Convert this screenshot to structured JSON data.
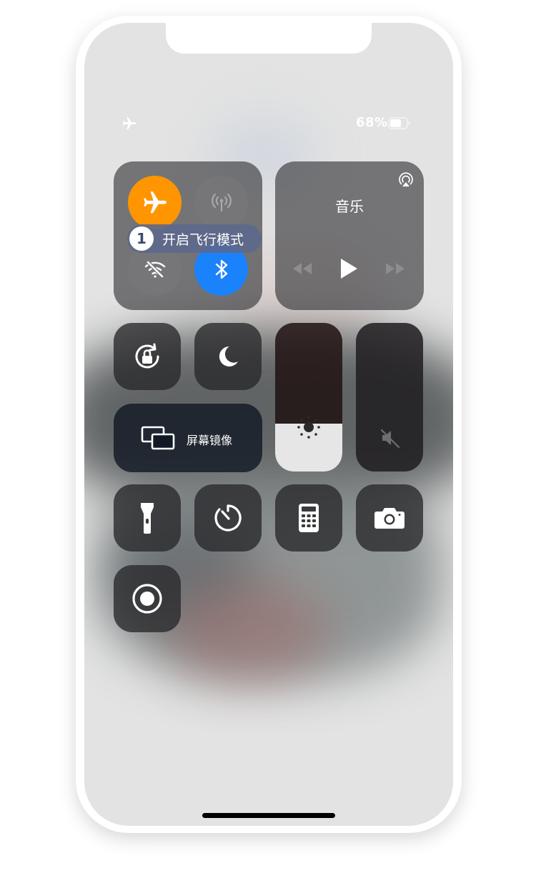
{
  "status_bar": {
    "airplane_icon": "airplane-icon",
    "battery_percent": "68%",
    "battery_level": 0.68
  },
  "connectivity": {
    "airplane": {
      "icon": "airplane-icon",
      "on": true,
      "color": "#ff9500"
    },
    "cellular": {
      "icon": "antenna-icon",
      "on": false
    },
    "wifi": {
      "icon": "wifi-off-icon",
      "on": false
    },
    "bluetooth": {
      "icon": "bluetooth-icon",
      "on": true,
      "color": "#1a82fb"
    }
  },
  "tooltip": {
    "number": "1",
    "text": "开启飞行模式"
  },
  "music": {
    "title": "音乐",
    "airplay_icon": "airplay-icon"
  },
  "screen_mirroring": {
    "label": "屏幕镜像",
    "icon": "screen-mirror-icon"
  },
  "brightness": {
    "level": 0.32,
    "icon": "sun-icon"
  },
  "volume": {
    "level": 0.0,
    "icon": "mute-icon"
  },
  "controls": [
    "orientation-lock-icon",
    "moon-icon",
    "flashlight-icon",
    "timer-icon",
    "calculator-icon",
    "camera-icon",
    "screen-record-icon"
  ]
}
